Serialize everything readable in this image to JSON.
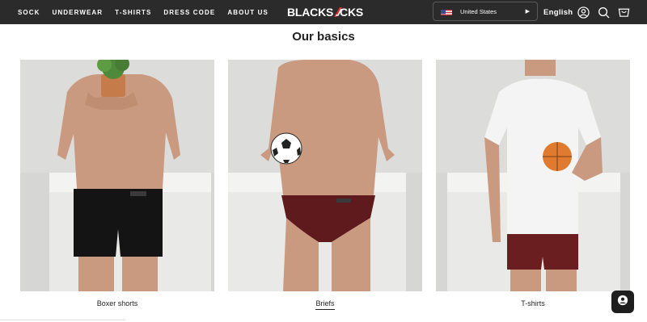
{
  "header": {
    "nav": [
      "SOCK",
      "UNDERWEAR",
      "T-SHIRTS",
      "DRESS CODE",
      "ABOUT US"
    ],
    "logo_text_left": "BLACKS",
    "logo_text_right": "CKS",
    "country": "United States",
    "language": "English",
    "icons": [
      "account-icon",
      "search-icon",
      "cart-icon"
    ]
  },
  "section": {
    "title": "Our basics"
  },
  "cards": [
    {
      "caption": "Boxer shorts",
      "underwear_color": "#141414"
    },
    {
      "caption": "Briefs",
      "underwear_color": "#5e1a1c"
    },
    {
      "caption": "T-shirts",
      "underwear_color": "#6a1e20"
    }
  ],
  "colors": {
    "header_bg": "#2b2b2b",
    "photo_bg": "#d9d9d8",
    "skin": "#c99a80"
  }
}
